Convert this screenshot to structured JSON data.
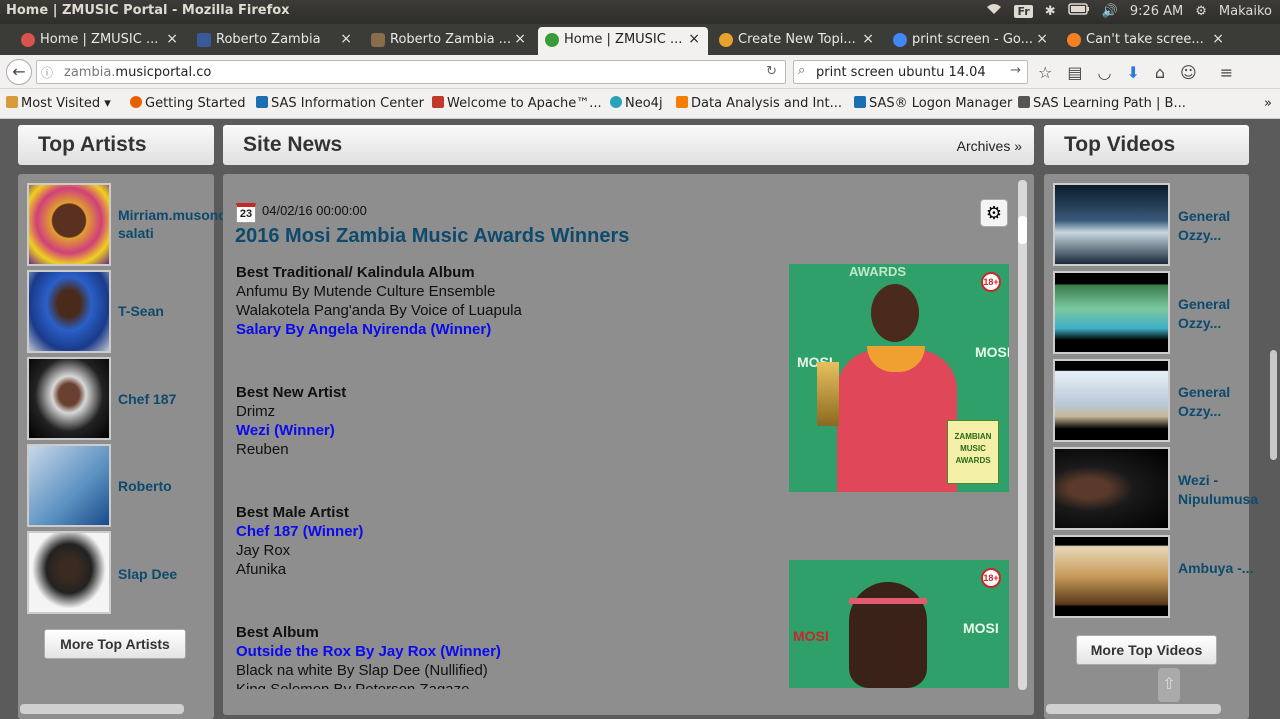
{
  "window": {
    "title": "Home | ZMUSIC Portal - Mozilla Firefox",
    "keyboard": "Fr",
    "time": "9:26 AM",
    "user": "Makaiko"
  },
  "tabs": [
    {
      "label": "Home | ZMUSIC ...",
      "close": "×",
      "color": "#d9534f"
    },
    {
      "label": "Roberto Zambia",
      "close": "×",
      "color": "#3b5998"
    },
    {
      "label": "Roberto Zambia ...",
      "close": "×",
      "color": "#8a6d4a"
    },
    {
      "label": "Home | ZMUSIC ...",
      "close": "×",
      "color": "#d9534f"
    },
    {
      "label": "Create New Topi...",
      "close": "×",
      "color": "#e8a12a"
    },
    {
      "label": "print screen - Go...",
      "close": "×",
      "color": "#4285f4"
    },
    {
      "label": "Can't take scree...",
      "close": "×",
      "color": "#f48024"
    }
  ],
  "new_tab": "+",
  "nav": {
    "url_prefix": "zambia.",
    "url_domain": "musicportal.co",
    "search_query": "print screen ubuntu 14.04"
  },
  "bookmarks": [
    {
      "label": "Most Visited ▾",
      "color": "#d89a3a"
    },
    {
      "label": "Getting Started",
      "color": "#e66000"
    },
    {
      "label": "SAS Information Center",
      "color": "#1a6fb0"
    },
    {
      "label": "Welcome to Apache™...",
      "color": "#c0392b"
    },
    {
      "label": "Neo4j",
      "color": "#2aa3b8"
    },
    {
      "label": "Data Analysis and Int...",
      "color": "#f57d00"
    },
    {
      "label": "SAS® Logon Manager",
      "color": "#1a6fb0"
    },
    {
      "label": "SAS Learning Path | B...",
      "color": "#555555"
    }
  ],
  "bookmarks_more": "»",
  "top_artists": {
    "heading": "Top Artists",
    "items": [
      {
        "name": "Mirriam.musonda salati"
      },
      {
        "name": "T-Sean"
      },
      {
        "name": "Chef 187"
      },
      {
        "name": "Roberto"
      },
      {
        "name": "Slap Dee"
      }
    ],
    "more_label": "More Top Artists"
  },
  "site_news": {
    "heading": "Site News",
    "archives": "Archives »",
    "calendar_day": "23",
    "date": "04/02/16 00:00:00",
    "title": "2016 Mosi Zambia Music Awards Winners",
    "lines": [
      {
        "text": "Best Traditional/ Kalindula Album",
        "kind": "cat"
      },
      {
        "text": "Anfumu By Mutende Culture Ensemble",
        "kind": "plain"
      },
      {
        "text": "Walakotela Pang'anda By Voice of Luapula",
        "kind": "plain"
      },
      {
        "text": "Salary By Angela Nyirenda (Winner)",
        "kind": "win"
      },
      {
        "text": "Best New Artist",
        "kind": "cat"
      },
      {
        "text": "Drimz",
        "kind": "plain"
      },
      {
        "text": "Wezi (Winner)",
        "kind": "win"
      },
      {
        "text": "Reuben",
        "kind": "plain"
      },
      {
        "text": "Best Male Artist",
        "kind": "cat"
      },
      {
        "text": "Chef 187 (Winner)",
        "kind": "win"
      },
      {
        "text": "Jay Rox",
        "kind": "plain"
      },
      {
        "text": "Afunika",
        "kind": "plain"
      },
      {
        "text": "Best Album",
        "kind": "cat"
      },
      {
        "text": "Outside the Rox By Jay Rox (Winner)",
        "kind": "win"
      },
      {
        "text": "Black na white By Slap Dee (Nullified)",
        "kind": "plain"
      },
      {
        "text": "King Solomon By Peterson Zagaze",
        "kind": "plain"
      }
    ],
    "img1": {
      "awards_text": "AWARDS",
      "badge": "18+",
      "brand": "MOSI",
      "logo_l1": "ZAMBIAN",
      "logo_l2": "MUSIC",
      "logo_l3": "AWARDS"
    },
    "img2": {
      "badge": "18+",
      "brand": "MOSI"
    }
  },
  "top_videos": {
    "heading": "Top Videos",
    "items": [
      {
        "name": "General Ozzy..."
      },
      {
        "name": "General Ozzy..."
      },
      {
        "name": "General Ozzy..."
      },
      {
        "name": "Wezi - Nipulumusa"
      },
      {
        "name": "Ambuya -..."
      }
    ],
    "more_label": "More Top Videos"
  }
}
